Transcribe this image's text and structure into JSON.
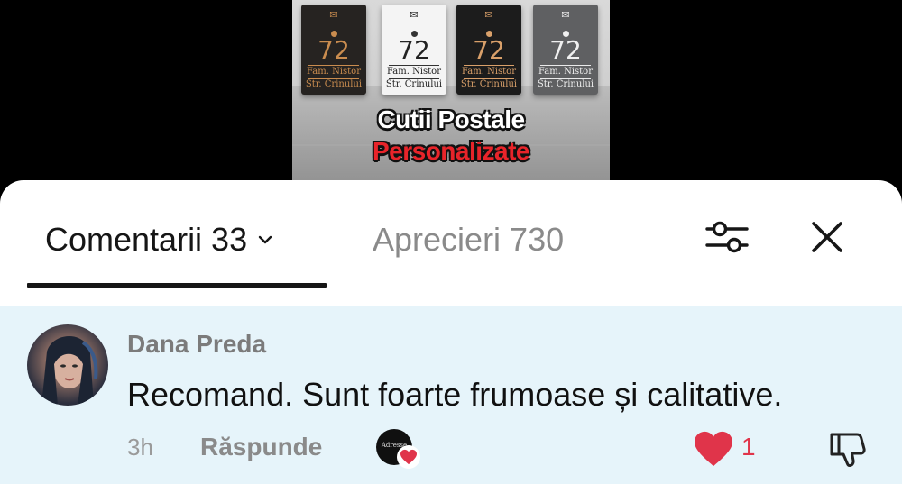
{
  "video": {
    "mailboxes": [
      {
        "number": "72",
        "line1": "Fam. Nistor",
        "line2": "Str. Crinului",
        "style": "dark"
      },
      {
        "number": "72",
        "line1": "Fam. Nistor",
        "line2": "Str. Crinului",
        "style": "white"
      },
      {
        "number": "72",
        "line1": "Fam. Nistor",
        "line2": "Str. Crinului",
        "style": "black"
      },
      {
        "number": "72",
        "line1": "Fam. Nistor",
        "line2": "Str. Crinului",
        "style": "grey"
      }
    ],
    "caption_line1": "Cutii Postale",
    "caption_line2": "Personalizate",
    "envelope_glyph": "✉"
  },
  "tabs": {
    "comments_label": "Comentarii 33",
    "likes_label": "Aprecieri 730"
  },
  "comment": {
    "author": "Dana Preda",
    "text": "Recomand. Sunt foarte frumoase și calitative.",
    "time": "3h",
    "reply_label": "Răspunde",
    "creator_avatar_text": "Adresse",
    "like_count": "1"
  },
  "colors": {
    "comment_highlight": "#e6f4fa",
    "like_red": "#e0344a",
    "caption_red": "#e8242a"
  },
  "icons": {
    "filter": "sliders-icon",
    "close": "close-icon",
    "chevron": "chevron-down-icon",
    "like": "heart-icon",
    "dislike": "thumbs-down-icon"
  }
}
